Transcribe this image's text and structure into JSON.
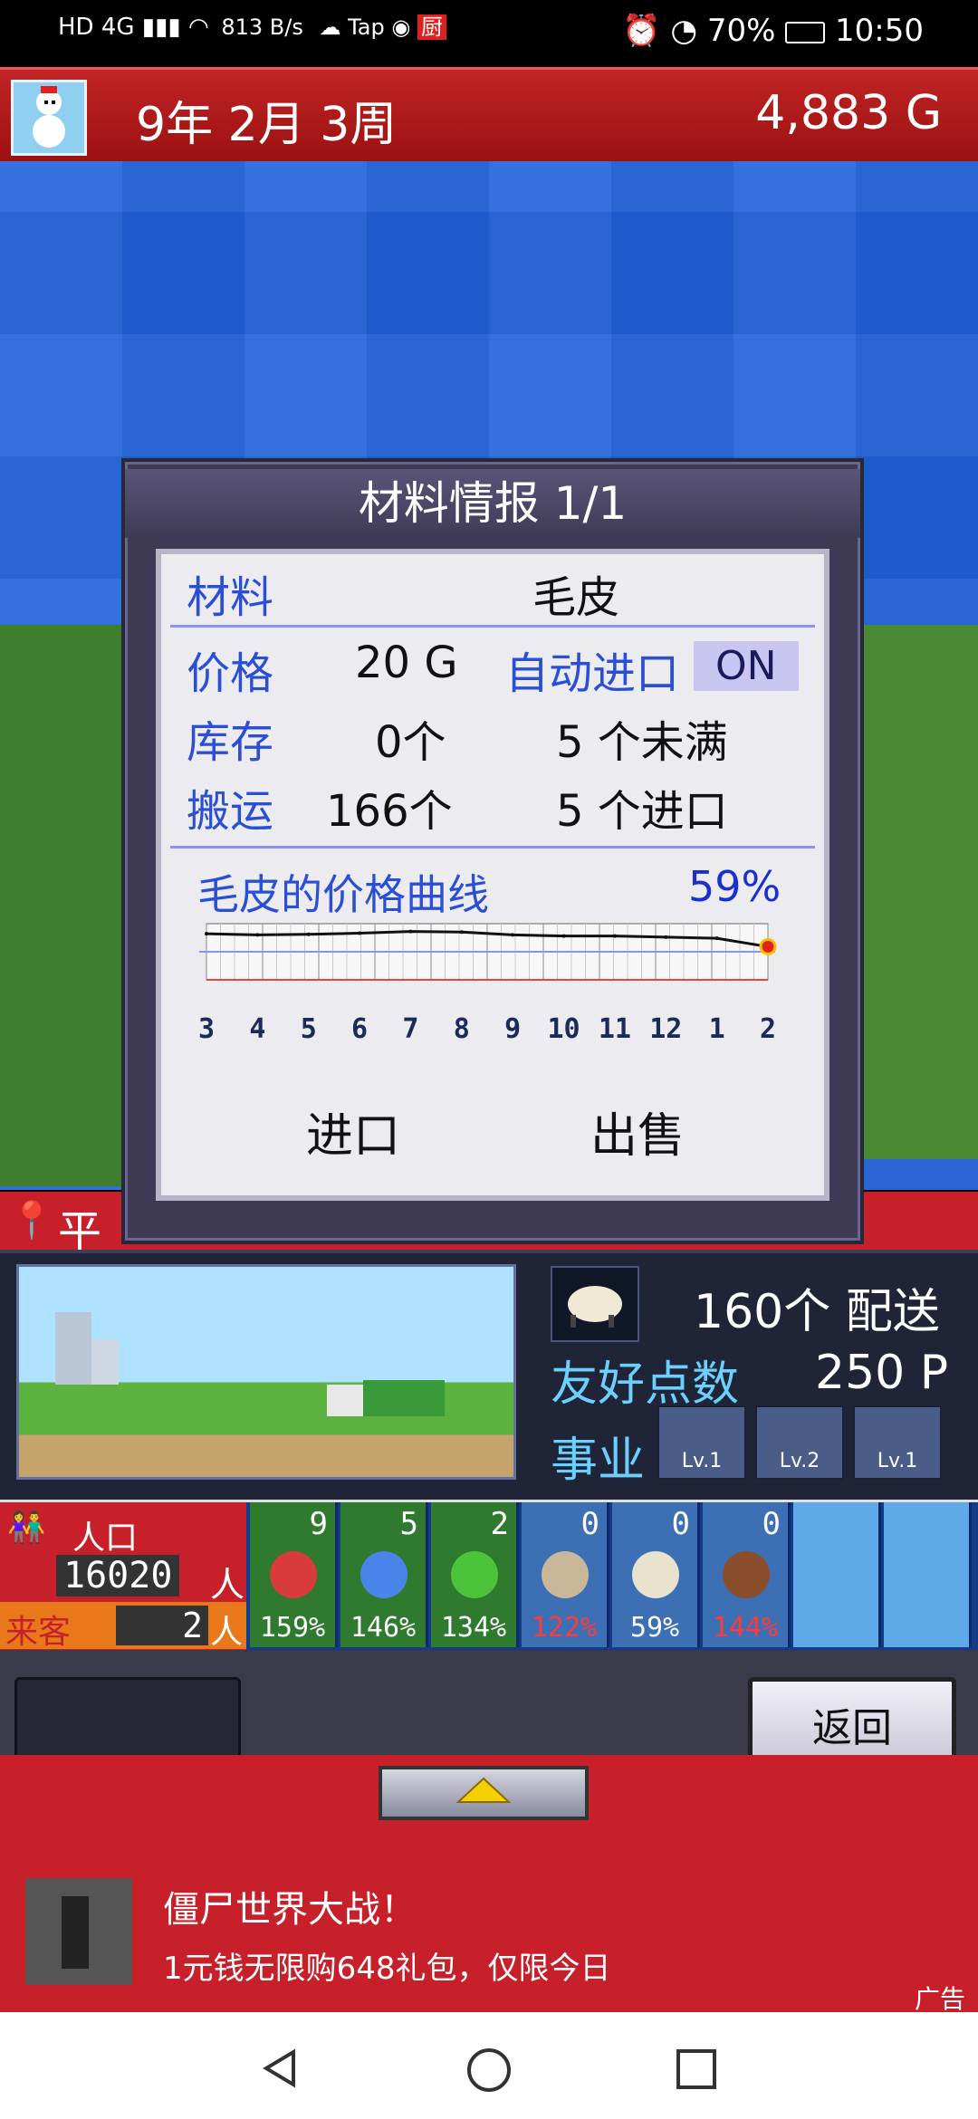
{
  "status_bar": {
    "left": "HD 4G ▮ 813 B/s  Tap 厨",
    "speed": "813",
    "speed_unit": "B/s",
    "battery": "70%",
    "time": "10:50"
  },
  "header": {
    "date": "9年 2月 3周",
    "gold": "4,883 G"
  },
  "dialog": {
    "title": "材料情报 1/1",
    "material_label": "材料",
    "material_value": "毛皮",
    "price_label": "价格",
    "price_value": "20 G",
    "auto_import_label": "自动进口",
    "auto_import_value": "ON",
    "stock_label": "库存",
    "stock_value": "0个",
    "shortage_value": "5 个未满",
    "transport_label": "搬运",
    "transport_value": "166个",
    "import_value": "5 个进口",
    "curve_title": "毛皮的价格曲线",
    "curve_percent": "59%",
    "import_button": "进口",
    "sell_button": "出售"
  },
  "chart_data": {
    "type": "line",
    "title": "毛皮的价格曲线",
    "categories": [
      "3",
      "4",
      "5",
      "6",
      "7",
      "8",
      "9",
      "10",
      "11",
      "12",
      "1",
      "2"
    ],
    "values": [
      82,
      80,
      81,
      83,
      86,
      85,
      80,
      78,
      78,
      76,
      74,
      59
    ],
    "ylim": [
      0,
      100
    ],
    "highlight": "59%",
    "grid": true
  },
  "lower": {
    "delivery": "160个 配送",
    "friendship_label": "友好点数",
    "friendship_value": "250 P",
    "business_label": "事业",
    "business_levels": [
      "Lv.1",
      "Lv.2",
      "Lv.1"
    ],
    "place_label": "平"
  },
  "strip": {
    "population_label": "人口",
    "population_value": "16020",
    "population_unit": "人",
    "visitors_label": "来客",
    "visitors_value": "2",
    "visitors_unit": "人",
    "slots": [
      {
        "count": "9",
        "pct": "159%",
        "color": "#d93a3a",
        "bg": "#2f7a2f",
        "pct_color": "#ffffff"
      },
      {
        "count": "5",
        "pct": "146%",
        "color": "#4a86ea",
        "bg": "#2f7a2f",
        "pct_color": "#ffffff"
      },
      {
        "count": "2",
        "pct": "134%",
        "color": "#4cc33a",
        "bg": "#2f7a2f",
        "pct_color": "#ffffff"
      },
      {
        "count": "0",
        "pct": "122%",
        "color": "#c9b79a",
        "bg": "#3d6fb5",
        "pct_color": "#ff3a3a"
      },
      {
        "count": "0",
        "pct": "59%",
        "color": "#e9e2cf",
        "bg": "#3d6fb5",
        "pct_color": "#ffffff"
      },
      {
        "count": "0",
        "pct": "144%",
        "color": "#8a4e2a",
        "bg": "#3d6fb5",
        "pct_color": "#ff3a3a"
      },
      {
        "count": "",
        "pct": "",
        "color": "transparent",
        "bg": "#5fa9e8",
        "pct_color": "#ffffff"
      },
      {
        "count": "",
        "pct": "",
        "color": "transparent",
        "bg": "#5fa9e8",
        "pct_color": "#ffffff"
      }
    ]
  },
  "controls": {
    "back_button": "返回"
  },
  "ad": {
    "title": "僵尸世界大战！",
    "subtitle": "1元钱无限购648礼包，仅限今日",
    "tag": "广告"
  }
}
